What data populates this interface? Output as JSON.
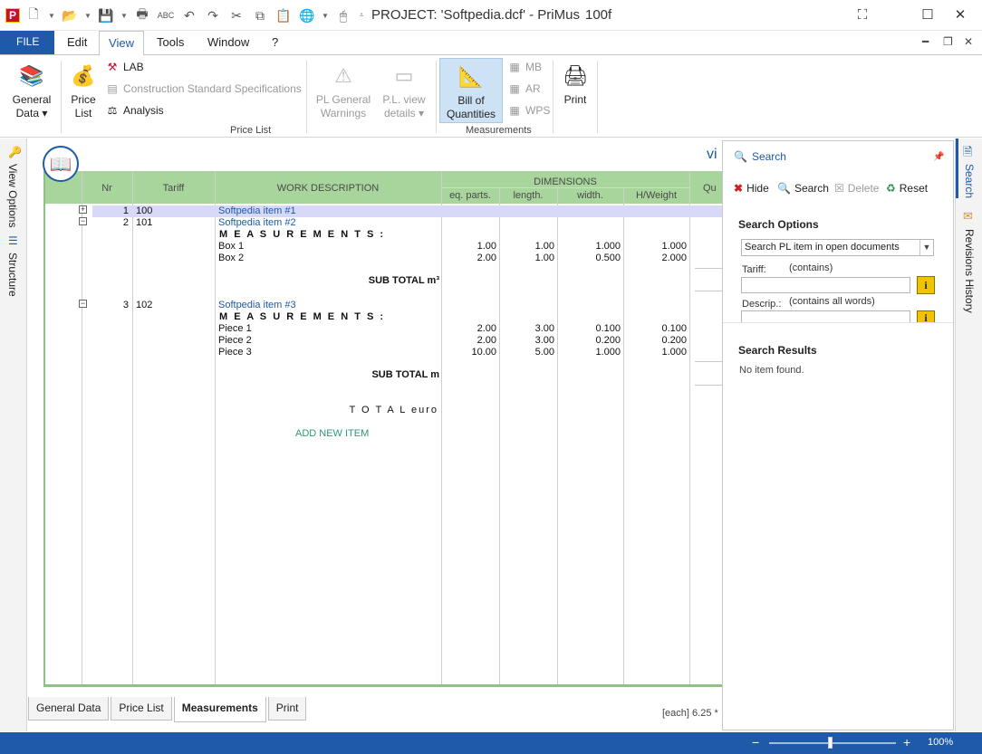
{
  "window": {
    "title": "PROJECT: 'Softpedia.dcf' - PriMus",
    "version": "100f"
  },
  "menu": {
    "file": "FILE",
    "items": [
      "Edit",
      "View",
      "Tools",
      "Window",
      "?"
    ]
  },
  "ribbon": {
    "general_data": "General",
    "general_data_2": "Data",
    "price_list": "Price",
    "price_list_2": "List",
    "lab": "LAB",
    "construction_specs": "Construction Standard Specifications",
    "analysis": "Analysis",
    "pl_general_warnings": "PL General",
    "pl_general_warnings_2": "Warnings",
    "pl_view_details": "P.L. view",
    "pl_view_details_2": "details",
    "group_price_list": "Price List",
    "bill_of_quantities": "Bill of",
    "bill_of_quantities_2": "Quantities",
    "mb": "MB",
    "ar": "AR",
    "wps": "WPS",
    "group_measurements": "Measurements",
    "print": "Print"
  },
  "side": {
    "view_options": "View Options",
    "structure": "Structure",
    "search": "Search",
    "revisions_history": "Revisions History"
  },
  "main": {
    "view_label_cut": "vi"
  },
  "grid": {
    "headers": {
      "nr": "Nr",
      "tariff": "Tariff",
      "work_description": "WORK DESCRIPTION",
      "dimensions": "DIMENSIONS",
      "eq_parts": "eq. parts.",
      "length": "length.",
      "width": "width.",
      "hweight": "H/Weight",
      "qu_cut": "Qu"
    },
    "items": [
      {
        "nr": "1",
        "tariff": "100",
        "desc": "Softpedia item #1"
      },
      {
        "nr": "2",
        "tariff": "101",
        "desc": "Softpedia item #2"
      },
      {
        "nr": "3",
        "tariff": "102",
        "desc": "Softpedia item #3"
      }
    ],
    "measurements_label": "M E A S U R E M E N T S :",
    "item2_rows": [
      {
        "desc": "Box 1",
        "eq": "1.00",
        "len": "1.00",
        "wid": "1.000",
        "hw": "1.000"
      },
      {
        "desc": "Box 2",
        "eq": "2.00",
        "len": "1.00",
        "wid": "0.500",
        "hw": "2.000"
      }
    ],
    "subtotal_1": "SUB TOTAL m³",
    "item3_rows": [
      {
        "desc": "Piece 1",
        "eq": "2.00",
        "len": "3.00",
        "wid": "0.100",
        "hw": "0.100"
      },
      {
        "desc": "Piece 2",
        "eq": "2.00",
        "len": "3.00",
        "wid": "0.200",
        "hw": "0.200"
      },
      {
        "desc": "Piece 3",
        "eq": "10.00",
        "len": "5.00",
        "wid": "1.000",
        "hw": "1.000"
      }
    ],
    "subtotal_2": "SUB TOTAL m",
    "total": "T O T A L  euro",
    "add_new_item": "ADD NEW ITEM"
  },
  "tabs": [
    "General Data",
    "Price List",
    "Measurements",
    "Print"
  ],
  "active_tab": "Measurements",
  "unit_note": "[each] 6.25 *",
  "search_panel": {
    "title": "Search",
    "hide": "Hide",
    "search": "Search",
    "delete": "Delete",
    "reset": "Reset",
    "options_heading": "Search Options",
    "scope_select": "Search PL item in open documents",
    "tariff_label": "Tariff:",
    "tariff_hint": "(contains)",
    "descrip_label": "Descrip.:",
    "descrip_hint": "(contains all words)",
    "info_glyph": "i",
    "results_heading": "Search Results",
    "no_item": "No item found."
  },
  "status": {
    "zoom": "100%"
  },
  "colors": {
    "accent": "#1e5aa8",
    "grid_header": "#a8d59c",
    "row_highlight": "#d8d8f8",
    "info_button": "#f0c400"
  },
  "icons": [
    "app-icon",
    "new-doc-icon",
    "open-folder-icon",
    "save-icon",
    "printer-icon",
    "spellcheck-icon",
    "undo-icon",
    "redo-icon",
    "cut-icon",
    "copy-icon",
    "paste-icon",
    "globe-icon",
    "mouse-icon",
    "book-icon",
    "search-icon",
    "hide-icon",
    "delete-icon",
    "reset-icon",
    "pin-icon"
  ]
}
